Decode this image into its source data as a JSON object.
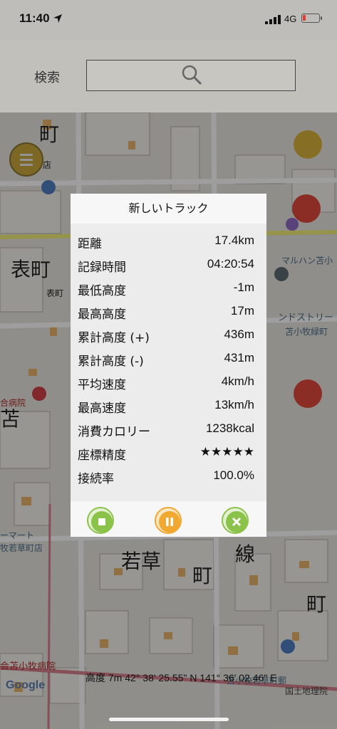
{
  "status_bar": {
    "time": "11:40",
    "network": "4G",
    "battery_color": "#e53b2e"
  },
  "search": {
    "label": "検索",
    "value": ""
  },
  "map": {
    "labels": [
      "町",
      "表町",
      "表町",
      "苫",
      "合病院",
      "ーマート",
      "牧若草町店",
      "若草",
      "町",
      "線",
      "町",
      "会苫小牧病院",
      "マルハン苫小",
      "ンドストリー",
      "苫小牧緑町",
      "苫小牧若草町郵",
      "店"
    ],
    "google_label": "Google",
    "gsi_label": "国土地理院"
  },
  "dialog": {
    "title": "新しいトラック",
    "rows": [
      {
        "key": "距離",
        "value": "17.4km"
      },
      {
        "key": "記録時間",
        "value": "04:20:54"
      },
      {
        "key": "最低高度",
        "value": "-1m"
      },
      {
        "key": "最高高度",
        "value": "17m"
      },
      {
        "key": "累計高度 (+)",
        "value": "436m"
      },
      {
        "key": "累計高度 (-)",
        "value": "431m"
      },
      {
        "key": "平均速度",
        "value": "4km/h"
      },
      {
        "key": "最高速度",
        "value": "13km/h"
      },
      {
        "key": "消費カロリー",
        "value": "1238kcal"
      },
      {
        "key": "座標精度",
        "value": "★★★★★"
      },
      {
        "key": "接続率",
        "value": "100.0%"
      }
    ],
    "buttons": [
      {
        "name": "stop",
        "icon": "stop-icon",
        "color": "#8bc34a"
      },
      {
        "name": "pause",
        "icon": "pause-icon",
        "color": "#f0a830"
      },
      {
        "name": "cancel",
        "icon": "close-icon",
        "color": "#8bc34a"
      }
    ]
  },
  "bottom": {
    "coords": "高度 7m  42° 38' 25.55\" N 141° 36' 02.46\" E"
  }
}
